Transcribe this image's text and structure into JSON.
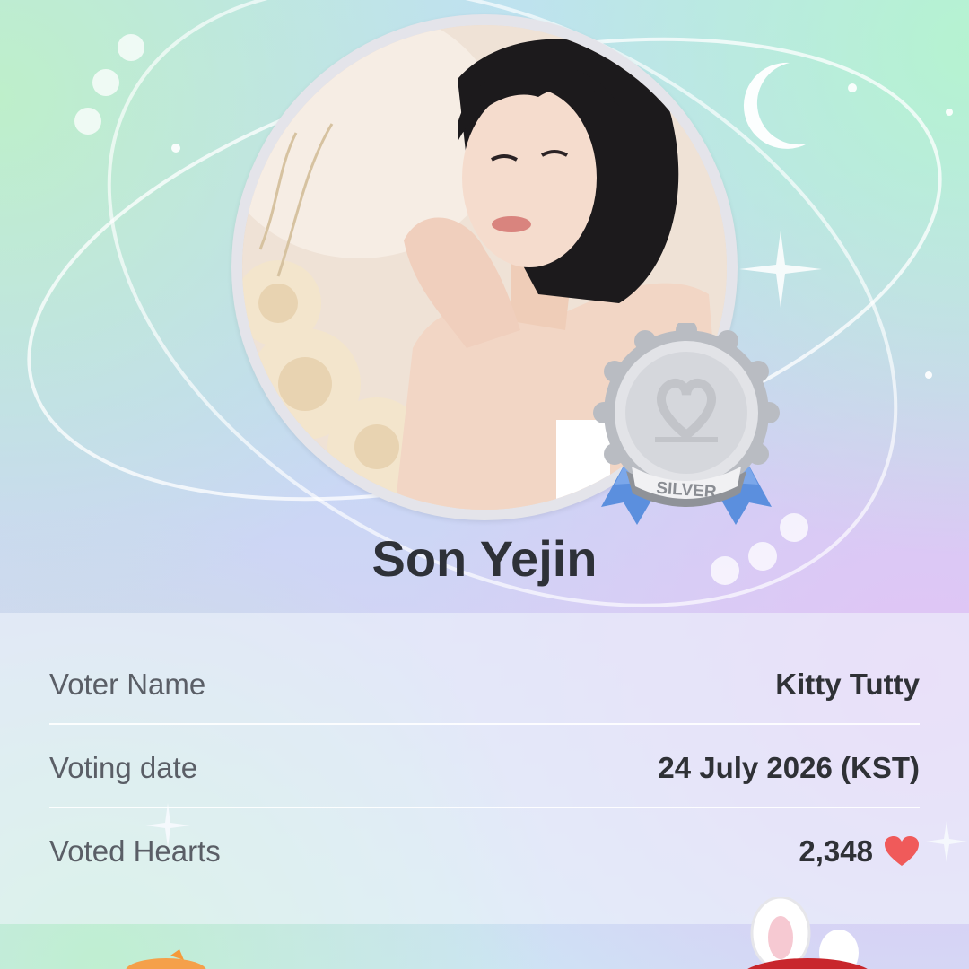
{
  "profile": {
    "name": "Son Yejin",
    "badge_text": "SILVER"
  },
  "details": [
    {
      "label": "Voter Name",
      "value": "Kitty Tutty"
    },
    {
      "label": "Voting date",
      "value": "24 July 2026 (KST)"
    },
    {
      "label": "Voted Hearts",
      "value": "2,348"
    }
  ],
  "colors": {
    "heart": "#f05a5a",
    "badge_silver": "#d5d7dc",
    "ribbon": "#5b8fde",
    "name_text": "#2e3138"
  },
  "icons": {
    "heart": "heart-icon",
    "medal": "medal-icon",
    "moon": "moon-icon",
    "sparkle": "sparkle-icon"
  }
}
